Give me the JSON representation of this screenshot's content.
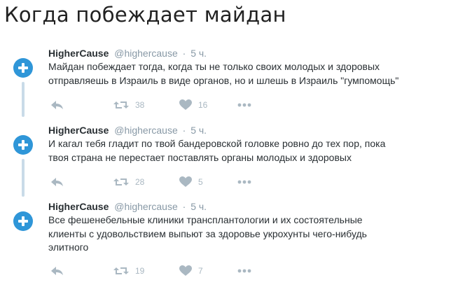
{
  "page": {
    "title": "Когда побеждает майдан"
  },
  "colors": {
    "accent": "#2f96d8",
    "muted": "#8899a6",
    "icon": "#aab8c2",
    "thread": "#c9dbe8"
  },
  "icons": {
    "reply": "reply-icon",
    "retweet": "retweet-icon",
    "like": "heart-icon",
    "more": "more-dots-icon",
    "avatar": "plus-icon"
  },
  "tweets": [
    {
      "name": "HigherCause",
      "handle": "@highercause",
      "dot": "·",
      "time": "5 ч.",
      "lines": [
        "Майдан побеждает тогда, когда ты не только своих молодых и здоровых",
        "отправляешь в Израиль в виде органов, но и  шлешь в Израиль \"гумпомощь\""
      ],
      "retweets": "38",
      "likes": "16"
    },
    {
      "name": "HigherCause",
      "handle": "@highercause",
      "dot": "·",
      "time": "5 ч.",
      "lines": [
        "И кагал тебя гладит по твой бандеровской головке ровно до тех пор, пока",
        "твоя страна не перестает поставлять органы молодых и здоровых"
      ],
      "retweets": "28",
      "likes": "5"
    },
    {
      "name": "HigherCause",
      "handle": "@highercause",
      "dot": "·",
      "time": "5 ч.",
      "lines": [
        "Все фешенебельные клиники трансплантологии и их состоятельные",
        "клиенты с удовольствием выпьют за здоровье укрохунты чего-нибудь",
        "элитного"
      ],
      "retweets": "19",
      "likes": "7"
    }
  ]
}
